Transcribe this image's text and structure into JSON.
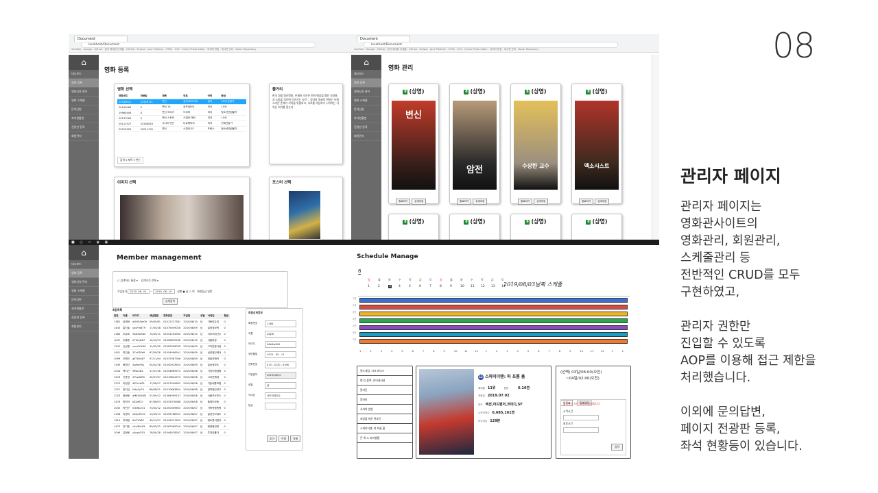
{
  "slide_number": "08",
  "side": {
    "title": "관리자 페이지",
    "paragraphs": [
      [
        "관리자 페이지는",
        "영화관사이트의",
        "영화관리, 회원관리,",
        "스케줄관리 등",
        "전반적인 CRUD를 모두",
        "구현하였고,"
      ],
      [
        "관리자 권한만",
        "진입할 수 있도록",
        "AOP를 이용해 접근 제한을",
        "처리했습니다."
      ],
      [
        "이외에 문의답변,",
        "페이지 전광판 등록,",
        "좌석 현황등이 있습니다."
      ]
    ]
  },
  "browser": {
    "tab_label": "Document",
    "url": "localhost/Document",
    "bookmarks": "YouTube · Google · GitHub · 참가 위대한 인재들 · GitHub · Eclipse · Java Platform · HTML · CSS · Online Photo Editor · 이미지 편집 · 게시판 관리 · Naver Repository"
  },
  "sidebar": {
    "home_icon": "⌂",
    "items": [
      "대시보드",
      "영화 등록",
      "영화상영 관리",
      "영화 스케줄",
      "문의답변",
      "좌석현황판",
      "전광판 등록",
      "회원관리"
    ]
  },
  "movie_register": {
    "page_title": "영화 등록",
    "movie_select_title": "영화 선택",
    "table_headers": [
      "영화코드",
      "개봉일",
      "제목",
      "장르",
      "국적",
      "등급"
    ],
    "rows": [
      [
        "20186621",
        "20190711",
        "변신",
        "호러,미스터리",
        "한국",
        "15세 관람가"
      ],
      [
        "20190063",
        "X",
        "변신 14",
        "공포(호러)",
        "미국",
        "15세"
      ],
      [
        "19980406",
        "X",
        "변신 이야기",
        "드라마",
        "미국",
        "청소년관람불가"
      ],
      [
        "20137263",
        "X",
        "변신 스토리",
        "스릴러,액션",
        "미국",
        "15세"
      ],
      [
        "20111527",
        "20180818",
        "사나이 변신",
        "다큐멘터리",
        "미국",
        "전체관람가"
      ],
      [
        "20013309",
        "20011199",
        "변신",
        "스릴러,SF",
        "프랑스",
        "청소년관람불가"
      ]
    ],
    "search_label": "검색",
    "plot_title": "줄거리",
    "plot_text": "한국 부활 정신병원, 은재와 조인은 전혀 예상을 했던 사람들과 소동을 겪으며 이어가는 사건... 악마의 얼굴로 변하는 비밀스러운 존재가 가족을 위협하고, 서로를 의심하기 시작하는 가족은 위기를 맞는다.",
    "image_select_title": "이미지 선택",
    "poster_select_title": "포스터 선택"
  },
  "movie_manage": {
    "page_title": "영화 관리",
    "status_label": "(상영)",
    "cards": [
      {
        "title": "변신",
        "bg": "#3a1f1a",
        "accent": "#c23b2a"
      },
      {
        "title": "암전",
        "bg": "#2a2a2a",
        "accent": "#b89a7a"
      },
      {
        "title": "수상한 교수",
        "bg": "#9b8f7e",
        "accent": "#e4c05a"
      },
      {
        "title": "엑소시스트",
        "bg": "#3d2a1e",
        "accent": "#b0342a"
      }
    ],
    "btn_edit": "종료하기",
    "btn_detail": "상세이동"
  },
  "member": {
    "page_title": "Member management",
    "filter_labels": [
      "검색하는 통함",
      "검색조건 전체",
      "가입일자",
      "성별",
      "회원등급 일반",
      "상세검색"
    ],
    "date_from": "2019. 08. 01.",
    "date_to": "2019. 08. 10.",
    "list_title": "회원목록",
    "table_headers": [
      "번호",
      "이름",
      "아이디",
      "생년월일",
      "전화번호",
      "가입일",
      "성별",
      "닉네임",
      "등급"
    ],
    "rows": [
      [
        "1382",
        "남제현",
        "aDHQ3m09",
        "09/05/81",
        "01012227381",
        "2019/08/10",
        "남",
        "가동방유성",
        "0"
      ],
      [
        "1443",
        "홍진솔",
        "yzuFmB79",
        "17/04/28",
        "01079059028",
        "2019/08/09",
        "남",
        "일영정보학",
        "0"
      ],
      [
        "1184",
        "주유희",
        "9Ab3w9A0",
        "75/05/11",
        "01041204390",
        "2019/08/10",
        "남",
        "서초이대선수",
        "0"
      ],
      [
        "1047",
        "우흥원",
        "073mj667",
        "14/10/23",
        "01028699538",
        "2019/08/10",
        "남",
        "서울한광",
        "0"
      ],
      [
        "1242",
        "신상철",
        "xumFOk36",
        "11/05/30",
        "01087956028",
        "2019/08/09",
        "남",
        "그리운봄사랑",
        "0"
      ],
      [
        "1401",
        "박진솔",
        "3Cx03Pd9",
        "67/09/28",
        "01054906541",
        "2019/08/09",
        "남",
        "삼성첨단에서",
        "0"
      ],
      [
        "1099",
        "우원진",
        "gETk0h87",
        "57/11/04",
        "01037067346",
        "2019/08/09",
        "남",
        "비밀의해커",
        "0"
      ],
      [
        "1349",
        "봉영선",
        "5gEmFN1",
        "05/02/28",
        "01050923820",
        "2019/08/09",
        "남",
        "일상정보도",
        "0"
      ],
      [
        "1044",
        "백지근",
        "9iNu0D4",
        "17/07/28",
        "01054669572",
        "2019/08/08",
        "남",
        "기동이행생활",
        "0"
      ],
      [
        "1476",
        "기준영",
        "2PuwfaRS",
        "05/07/07",
        "01019844375",
        "2019/08/08",
        "남",
        "그리운행생",
        "0"
      ],
      [
        "1270",
        "이정영",
        "4lFOnXS3",
        "17/06/27",
        "01057099802",
        "2019/08/08",
        "남",
        "기동대통보험",
        "0"
      ],
      [
        "1221",
        "장지섭",
        "N4nGp74",
        "86/08/21",
        "01010863894",
        "2019/08/08",
        "남",
        "광역첨단연구",
        "0"
      ],
      [
        "1223",
        "정현웅",
        "aMKXiD461",
        "01/09/12",
        "01364099157",
        "2019/08/08",
        "남",
        "서울포르포수",
        "0"
      ],
      [
        "1476",
        "최민아",
        "kIDzM12",
        "67/06/03",
        "01033376388",
        "2019/08/08",
        "남",
        "플레이모동",
        "0"
      ],
      [
        "1045",
        "박민규",
        "0rDHp231",
        "73/04/12",
        "01050049603",
        "2019/08/07",
        "남",
        "가동한합동원",
        "0"
      ],
      [
        "1198",
        "지영하",
        "xKGpPh39",
        "13/09/13",
        "01095788929",
        "2019/08/07",
        "남",
        "일성연고대도",
        "0"
      ],
      [
        "1414",
        "이재형",
        "6LfTd582",
        "45/12/27",
        "01042317653",
        "2019/08/07",
        "남",
        "배트론이용자",
        "0"
      ],
      [
        "1473",
        "유기호",
        "u2e3Kh93",
        "89/05/22",
        "01067460016",
        "2019/08/07",
        "남",
        "배영웅연방",
        "0"
      ],
      [
        "1046",
        "유현웅",
        "uAvyh353",
        "76/04/28",
        "01046078267",
        "2019/08/07",
        "남",
        "투게임홀더",
        "0"
      ]
    ],
    "detail_title": "회원상세정보",
    "detail_labels": [
      "회원번호",
      "이름",
      "아이디",
      "생년월일",
      "전화번호",
      "가입일자",
      "성별",
      "닉네임",
      "등급"
    ],
    "detail_values": [
      "1184",
      "주유희",
      "9Ab3w9A0",
      "1975 - 05 - 11",
      "010 - 4120 - 4390",
      "2019/08/10",
      "남",
      "서초이대선수",
      ""
    ],
    "detail_buttons": [
      "추가",
      "수정",
      "삭제"
    ]
  },
  "schedule": {
    "page_title": "Schedule Manage",
    "month": "8",
    "weekdays": [
      "일",
      "월",
      "화",
      "수",
      "목",
      "금",
      "토",
      "일",
      "월",
      "화",
      "수",
      "목",
      "금",
      "토"
    ],
    "days": [
      "1",
      "2",
      "3",
      "4",
      "5",
      "6",
      "7",
      "8",
      "9",
      "10",
      "11",
      "12",
      "13",
      "14",
      "15",
      "16"
    ],
    "heading": "2019/08/03날짜 스케줄",
    "screen_labels": [
      "1관",
      "2관",
      "3관",
      "4관",
      "5관",
      "6관",
      "7관"
    ],
    "bar_colors": [
      "#3b6fd1",
      "#d94b3f",
      "#f0b323",
      "#2aa84f",
      "#8b4cc2",
      "#16a0c4",
      "#f07a2b"
    ],
    "hour_labels": [
      "1",
      "2",
      "3",
      "4",
      "5",
      "6",
      "7",
      "8",
      "9",
      "10",
      "11",
      "12",
      "1",
      "2",
      "3",
      "4",
      "5",
      "6",
      "7",
      "8",
      "9",
      "10",
      "11",
      "12",
      "1",
      "2"
    ],
    "movie_list": [
      "엔드게임: 다크 피닉스",
      "맨 인 블랙: 인터내셔널",
      "알라딘",
      "알라딘",
      "사자의 연원",
      "세상을 바꾼 변호인",
      "스파이더맨: 파 프롬 홈",
      "존 윅 3: 파라벨룸"
    ],
    "detail": {
      "title": "스파이더맨: 파 프롬 홈",
      "rating_badge": "12",
      "rows": [
        [
          "예매율",
          "11위",
          "평점",
          "6.16점"
        ],
        [
          "개봉일",
          "2019.07.02",
          "",
          ""
        ],
        [
          "장르",
          "액션,어드벤처,코미디,SF",
          "",
          ""
        ],
        [
          "누적관객수",
          "6,685,161명",
          "",
          ""
        ],
        [
          "러닝타임",
          "129분",
          "",
          ""
        ]
      ]
    },
    "select_title": "(선택) 03일/06:00(오전)",
    "select_sub": "~04일/02:00(오전)",
    "select_tabs": [
      "일정표",
      "중복일정"
    ],
    "select_warning": "입력하는 시간 15분이 필요합니다",
    "select_fields": [
      "시작시간",
      "종료시간"
    ],
    "select_button": "입력"
  }
}
